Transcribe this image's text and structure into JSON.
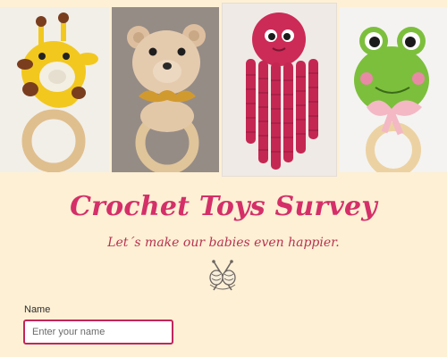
{
  "gallery": {
    "items": [
      {
        "icon": "giraffe-rattle-photo"
      },
      {
        "icon": "bear-rattle-photo"
      },
      {
        "icon": "octopus-toy-photo"
      },
      {
        "icon": "frog-rattle-photo"
      }
    ]
  },
  "header": {
    "title": "Crochet Toys Survey",
    "subtitle": "Let´s make our babies even happier."
  },
  "decor": {
    "icon": "yarn-needles-icon"
  },
  "form": {
    "name_label": "Name",
    "name_placeholder": "Enter your name",
    "name_value": ""
  },
  "colors": {
    "background": "#fdf0d5",
    "accent": "#d42f68",
    "input_border": "#c2255c"
  }
}
